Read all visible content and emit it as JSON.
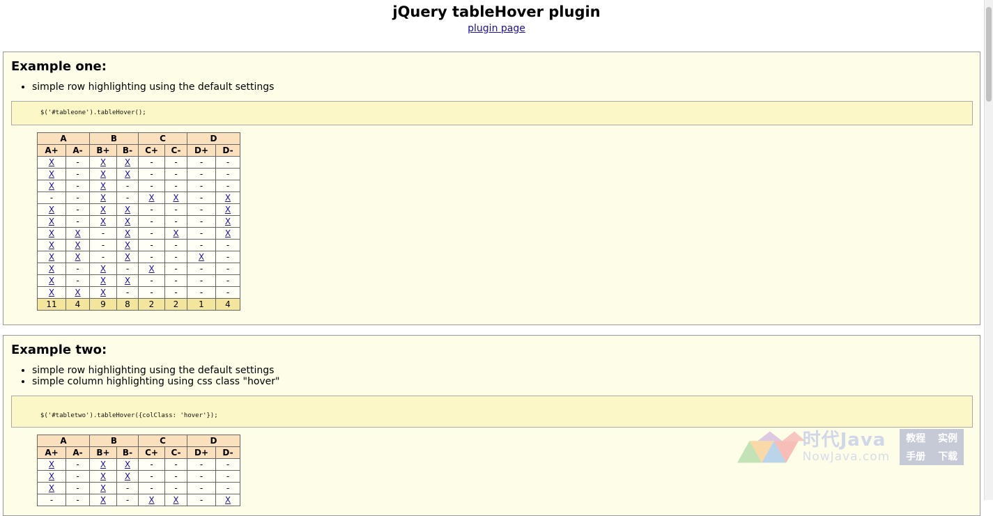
{
  "header": {
    "title": "jQuery tableHover plugin",
    "link": "plugin page"
  },
  "examples": [
    {
      "heading": "Example one:",
      "bullets": [
        "simple row highlighting using the default settings"
      ],
      "code": "$('#tableone').tableHover();",
      "groups": [
        "A",
        "B",
        "C",
        "D"
      ],
      "subheaders": [
        "A+",
        "A-",
        "B+",
        "B-",
        "C+",
        "C-",
        "D+",
        "D-"
      ],
      "rows": [
        [
          "X",
          "-",
          "X",
          "X",
          "-",
          "-",
          "-",
          "-"
        ],
        [
          "X",
          "-",
          "X",
          "X",
          "-",
          "-",
          "-",
          "-"
        ],
        [
          "X",
          "-",
          "X",
          "-",
          "-",
          "-",
          "-",
          "-"
        ],
        [
          "-",
          "-",
          "X",
          "-",
          "X",
          "X",
          "-",
          "X"
        ],
        [
          "X",
          "-",
          "X",
          "X",
          "-",
          "-",
          "-",
          "X"
        ],
        [
          "X",
          "-",
          "X",
          "X",
          "-",
          "-",
          "-",
          "X"
        ],
        [
          "X",
          "X",
          "-",
          "X",
          "-",
          "X",
          "-",
          "X"
        ],
        [
          "X",
          "X",
          "-",
          "X",
          "-",
          "-",
          "-",
          "-"
        ],
        [
          "X",
          "X",
          "-",
          "X",
          "-",
          "-",
          "X",
          "-"
        ],
        [
          "X",
          "-",
          "X",
          "-",
          "X",
          "-",
          "-",
          "-"
        ],
        [
          "X",
          "-",
          "X",
          "X",
          "-",
          "-",
          "-",
          "-"
        ],
        [
          "X",
          "X",
          "X",
          "-",
          "-",
          "-",
          "-",
          "-"
        ]
      ],
      "totals": [
        "11",
        "4",
        "9",
        "8",
        "2",
        "2",
        "1",
        "4"
      ]
    },
    {
      "heading": "Example two:",
      "bullets": [
        "simple row highlighting using the default settings",
        "simple column highlighting using css class \"hover\""
      ],
      "code": "$('#tabletwo').tableHover({colClass: 'hover'});",
      "groups": [
        "A",
        "B",
        "C",
        "D"
      ],
      "subheaders": [
        "A+",
        "A-",
        "B+",
        "B-",
        "C+",
        "C-",
        "D+",
        "D-"
      ],
      "rows": [
        [
          "X",
          "-",
          "X",
          "X",
          "-",
          "-",
          "-",
          "-"
        ],
        [
          "X",
          "-",
          "X",
          "X",
          "-",
          "-",
          "-",
          "-"
        ],
        [
          "X",
          "-",
          "X",
          "-",
          "-",
          "-",
          "-",
          "-"
        ],
        [
          "-",
          "-",
          "X",
          "-",
          "X",
          "X",
          "-",
          "X"
        ]
      ]
    }
  ],
  "watermark": {
    "cn": "时代Java",
    "en": "NowJava.com",
    "box": [
      "教程",
      "实例",
      "手册",
      "下载"
    ],
    "colors": [
      "#f4a3a3",
      "#f7c98b",
      "#a9d6a0",
      "#9cc3ea",
      "#c9a6e0"
    ]
  }
}
